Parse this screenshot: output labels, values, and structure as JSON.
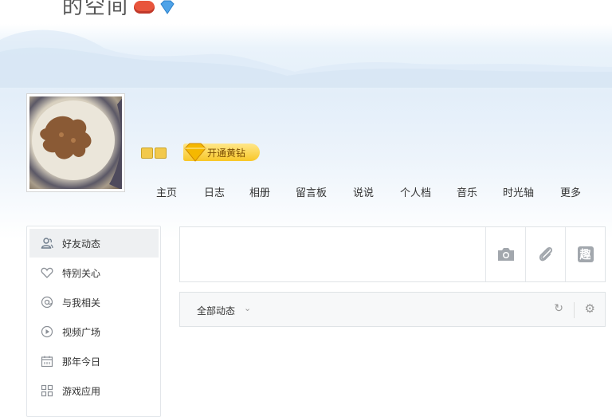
{
  "header": {
    "owner_name": "的空间"
  },
  "vip": {
    "open_label": "开通黄钻"
  },
  "nav": {
    "items": [
      "主页",
      "日志",
      "相册",
      "留言板",
      "说说",
      "个人档",
      "音乐",
      "时光轴",
      "更多"
    ]
  },
  "sidebar": {
    "items": [
      {
        "label": "好友动态",
        "icon": "friends-icon"
      },
      {
        "label": "特别关心",
        "icon": "heart-icon"
      },
      {
        "label": "与我相关",
        "icon": "at-icon"
      },
      {
        "label": "视频广场",
        "icon": "play-icon"
      },
      {
        "label": "那年今日",
        "icon": "calendar-icon"
      },
      {
        "label": "游戏应用",
        "icon": "apps-icon"
      }
    ]
  },
  "composer": {
    "tools": [
      "camera-icon",
      "attachment-icon",
      "fun-icon"
    ],
    "fun_glyph": "趣"
  },
  "feed_filter": {
    "label": "全部动态"
  },
  "colors": {
    "sky": "#e3eef9",
    "vip_gold": "#f8c728",
    "active_bg": "#eef0f2"
  }
}
